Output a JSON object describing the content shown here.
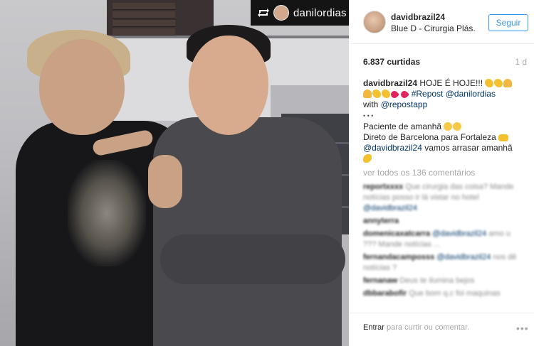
{
  "repost_overlay": {
    "username": "danilordias",
    "icon": "repost-icon"
  },
  "post": {
    "header": {
      "username": "davidbrazil24",
      "location": "Blue D - Cirurgia Plás...",
      "follow_label": "Seguir"
    },
    "likes": "6.837 curtidas",
    "time": "1 d",
    "caption": {
      "username": "davidbrazil24",
      "text1": "HOJE É HOJE!!!",
      "repost_tag": "#Repost",
      "repost_user": "@danilordias",
      "with_text": "with",
      "repostapp": "@repostapp",
      "dots": "• • •",
      "line2": "Paciente de amanhã",
      "line3": "Direto de Barcelona para Fortaleza",
      "mention": "@davidbrazil24",
      "line4": "vamos arrasar amanhã"
    },
    "view_all": "ver todos os 136 comentários",
    "comments": [
      {
        "user": "reportxxxx",
        "text": "Que cirurgia das coisa? Mande notícias posso ir lá vistar no hotel",
        "link": "@davidbrazil24"
      },
      {
        "user": "annyterra",
        "text": "",
        "link": ""
      },
      {
        "user": "domenicaxatcarra",
        "text": "amo u ??? Mande notícias ...",
        "link": "@davidbrazil24"
      },
      {
        "user": "fernandacamposss",
        "text": "nos dê notícias ?",
        "link": "@davidbrazil24"
      },
      {
        "user": "fernanaw",
        "text": "Deus te ilumina bejos",
        "link": ""
      },
      {
        "user": "dbbarabofir",
        "text": "Que bom q.c foi maquinas",
        "link": ""
      }
    ],
    "footer": {
      "login_label": "Entrar",
      "rest_label": "para curtir ou comentar.",
      "more_icon": "more-options-icon"
    }
  }
}
